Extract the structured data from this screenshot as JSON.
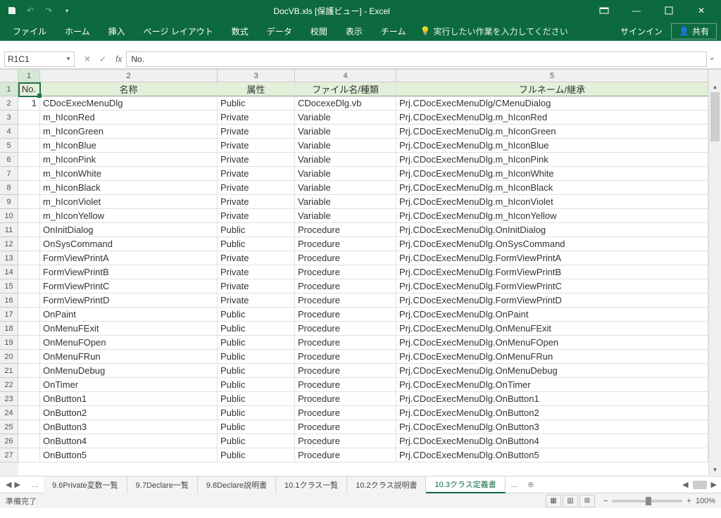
{
  "title": "DocVB.xls  [保護ビュー] - Excel",
  "qat": {
    "save": "💾"
  },
  "ribbon": {
    "tabs": [
      "ファイル",
      "ホーム",
      "挿入",
      "ページ レイアウト",
      "数式",
      "データ",
      "校閲",
      "表示",
      "チーム"
    ],
    "search_hint": "実行したい作業を入力してください",
    "signin": "サインイン",
    "share": "共有"
  },
  "namebox": "R1C1",
  "formula": "No.",
  "columns": [
    "1",
    "2",
    "3",
    "4",
    "5"
  ],
  "headers": {
    "c1": "No.",
    "c2": "名称",
    "c3": "属性",
    "c4": "ファイル名/種類",
    "c5": "フルネーム/継承"
  },
  "rows": [
    {
      "n": "1",
      "name": "CDocExecMenuDlg",
      "attr": "Public",
      "file": "CDocexeDlg.vb",
      "full": "Prj.CDocExecMenuDlg/CMenuDialog"
    },
    {
      "n": "",
      "name": "m_hIconRed",
      "attr": "Private",
      "file": "Variable",
      "full": "Prj.CDocExecMenuDlg.m_hIconRed"
    },
    {
      "n": "",
      "name": "m_hIconGreen",
      "attr": "Private",
      "file": "Variable",
      "full": "Prj.CDocExecMenuDlg.m_hIconGreen"
    },
    {
      "n": "",
      "name": "m_hIconBlue",
      "attr": "Private",
      "file": "Variable",
      "full": "Prj.CDocExecMenuDlg.m_hIconBlue"
    },
    {
      "n": "",
      "name": "m_hIconPink",
      "attr": "Private",
      "file": "Variable",
      "full": "Prj.CDocExecMenuDlg.m_hIconPink"
    },
    {
      "n": "",
      "name": "m_hIconWhite",
      "attr": "Private",
      "file": "Variable",
      "full": "Prj.CDocExecMenuDlg.m_hIconWhite"
    },
    {
      "n": "",
      "name": "m_hIconBlack",
      "attr": "Private",
      "file": "Variable",
      "full": "Prj.CDocExecMenuDlg.m_hIconBlack"
    },
    {
      "n": "",
      "name": "m_hIconViolet",
      "attr": "Private",
      "file": "Variable",
      "full": "Prj.CDocExecMenuDlg.m_hIconViolet"
    },
    {
      "n": "",
      "name": "m_hIconYellow",
      "attr": "Private",
      "file": "Variable",
      "full": "Prj.CDocExecMenuDlg.m_hIconYellow"
    },
    {
      "n": "",
      "name": "OnInitDialog",
      "attr": "Public",
      "file": "Procedure",
      "full": "Prj.CDocExecMenuDlg.OnInitDialog"
    },
    {
      "n": "",
      "name": "OnSysCommand",
      "attr": "Public",
      "file": "Procedure",
      "full": "Prj.CDocExecMenuDlg.OnSysCommand"
    },
    {
      "n": "",
      "name": "FormViewPrintA",
      "attr": "Private",
      "file": "Procedure",
      "full": "Prj.CDocExecMenuDlg.FormViewPrintA"
    },
    {
      "n": "",
      "name": "FormViewPrintB",
      "attr": "Private",
      "file": "Procedure",
      "full": "Prj.CDocExecMenuDlg.FormViewPrintB"
    },
    {
      "n": "",
      "name": "FormViewPrintC",
      "attr": "Private",
      "file": "Procedure",
      "full": "Prj.CDocExecMenuDlg.FormViewPrintC"
    },
    {
      "n": "",
      "name": "FormViewPrintD",
      "attr": "Private",
      "file": "Procedure",
      "full": "Prj.CDocExecMenuDlg.FormViewPrintD"
    },
    {
      "n": "",
      "name": "OnPaint",
      "attr": "Public",
      "file": "Procedure",
      "full": "Prj.CDocExecMenuDlg.OnPaint"
    },
    {
      "n": "",
      "name": "OnMenuFExit",
      "attr": "Public",
      "file": "Procedure",
      "full": "Prj.CDocExecMenuDlg.OnMenuFExit"
    },
    {
      "n": "",
      "name": "OnMenuFOpen",
      "attr": "Public",
      "file": "Procedure",
      "full": "Prj.CDocExecMenuDlg.OnMenuFOpen"
    },
    {
      "n": "",
      "name": "OnMenuFRun",
      "attr": "Public",
      "file": "Procedure",
      "full": "Prj.CDocExecMenuDlg.OnMenuFRun"
    },
    {
      "n": "",
      "name": "OnMenuDebug",
      "attr": "Public",
      "file": "Procedure",
      "full": "Prj.CDocExecMenuDlg.OnMenuDebug"
    },
    {
      "n": "",
      "name": "OnTimer",
      "attr": "Public",
      "file": "Procedure",
      "full": "Prj.CDocExecMenuDlg.OnTimer"
    },
    {
      "n": "",
      "name": "OnButton1",
      "attr": "Public",
      "file": "Procedure",
      "full": "Prj.CDocExecMenuDlg.OnButton1"
    },
    {
      "n": "",
      "name": "OnButton2",
      "attr": "Public",
      "file": "Procedure",
      "full": "Prj.CDocExecMenuDlg.OnButton2"
    },
    {
      "n": "",
      "name": "OnButton3",
      "attr": "Public",
      "file": "Procedure",
      "full": "Prj.CDocExecMenuDlg.OnButton3"
    },
    {
      "n": "",
      "name": "OnButton4",
      "attr": "Public",
      "file": "Procedure",
      "full": "Prj.CDocExecMenuDlg.OnButton4"
    },
    {
      "n": "",
      "name": "OnButton5",
      "attr": "Public",
      "file": "Procedure",
      "full": "Prj.CDocExecMenuDlg.OnButton5"
    }
  ],
  "row_labels": [
    "1",
    "2",
    "3",
    "4",
    "5",
    "6",
    "7",
    "8",
    "9",
    "10",
    "11",
    "12",
    "13",
    "14",
    "15",
    "16",
    "17",
    "18",
    "19",
    "20",
    "21",
    "22",
    "23",
    "24",
    "25",
    "26",
    "27"
  ],
  "sheets": {
    "more": "...",
    "tabs": [
      "9.6Private変数一覧",
      "9.7Declare一覧",
      "9.8Declare説明書",
      "10.1クラス一覧",
      "10.2クラス説明書",
      "10.3クラス定義書"
    ],
    "active_index": 5
  },
  "status": {
    "ready": "準備完了",
    "zoom": "100%"
  }
}
